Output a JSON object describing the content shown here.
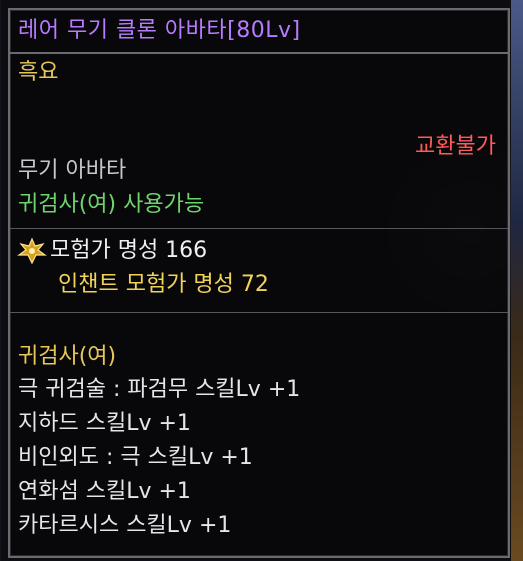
{
  "item": {
    "title": "레어 무기 클론 아바타[80Lv]",
    "subtype": "흑요",
    "trade_status": "교환불가",
    "category": "무기 아바타",
    "usable_class": "귀검사(여) 사용가능",
    "fame": "모험가 명성 166",
    "enchant_fame": "인챈트 모험가 명성 72",
    "job_label": "귀검사(여)",
    "skills": [
      "극 귀검술 : 파검무 스킬Lv +1",
      "지하드 스킬Lv +1",
      "비인외도 : 극 스킬Lv +1",
      "연화섬 스킬Lv +1",
      "카타르시스 스킬Lv +1"
    ]
  },
  "colors": {
    "title": "#b77bff",
    "subtype": "#e8c75a",
    "trade_status": "#ff5a5a",
    "category": "#c8c8c8",
    "usable_class": "#6ed46e",
    "fame": "#f0f0f0",
    "enchant_fame": "#f2d35a",
    "skills": "#e6e6e6"
  },
  "icons": {
    "fame": "fame-emblem-icon"
  }
}
